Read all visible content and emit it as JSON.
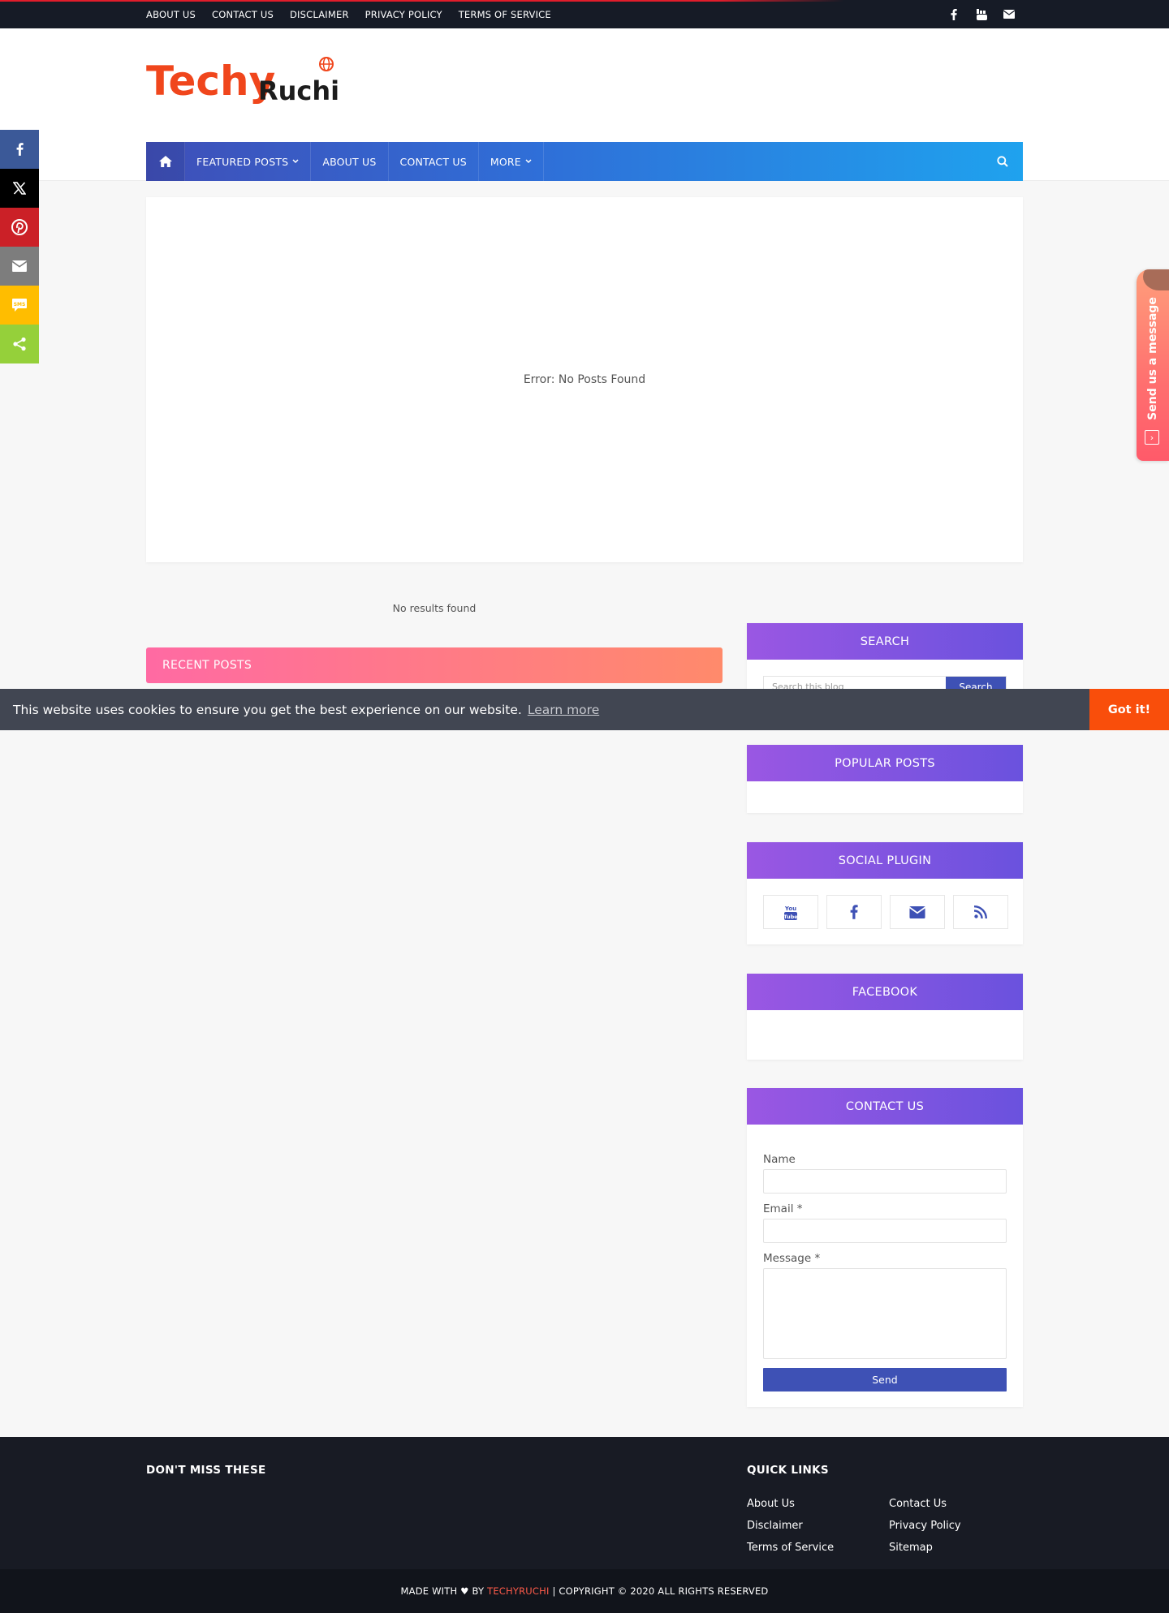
{
  "topbar": {
    "links": [
      "ABOUT US",
      "CONTACT US",
      "DISCLAIMER",
      "PRIVACY POLICY",
      "TERMS OF SERVICE"
    ],
    "social_icons": [
      "facebook-icon",
      "youtube-icon",
      "envelope-icon"
    ]
  },
  "logo": {
    "part1": "Techy",
    "part2": "Ruchi"
  },
  "nav": {
    "home_icon": "home-icon",
    "featured": "FEATURED POSTS",
    "about": "ABOUT US",
    "contact": "CONTACT US",
    "more": "MORE",
    "search_icon": "search-icon"
  },
  "featured": {
    "message": "Error: No Posts Found"
  },
  "main": {
    "no_results": "No results found",
    "recent_title": "RECENT POSTS"
  },
  "sidebar": {
    "search": {
      "title": "SEARCH",
      "placeholder": "Search this blog",
      "button": "Search"
    },
    "popular": {
      "title": "POPULAR POSTS"
    },
    "social": {
      "title": "SOCIAL PLUGIN",
      "icons": [
        "youtube-icon",
        "facebook-icon",
        "envelope-icon",
        "rss-icon"
      ]
    },
    "facebook": {
      "title": "FACEBOOK"
    },
    "contact": {
      "title": "CONTACT US",
      "name_label": "Name",
      "email_label": "Email *",
      "message_label": "Message *",
      "send": "Send"
    }
  },
  "cookie": {
    "text": "This website uses cookies to ensure you get the best experience on our website.",
    "learn_more": "Learn more",
    "got_it": "Got it!"
  },
  "footer": {
    "dont_miss": "DON'T MISS THESE",
    "quick_links_title": "QUICK LINKS",
    "quick_links": [
      "About Us",
      "Contact Us",
      "Disclaimer",
      "Privacy Policy",
      "Terms of Service",
      "Sitemap"
    ],
    "made_with": "MADE WITH ♥ BY",
    "brand": "TECHYRUCHI",
    "copyright": "| COPYRIGHT © 2020 ALL RIGHTS RESERVED"
  },
  "share_bar": {
    "buttons": [
      {
        "icon": "facebook-icon",
        "color": "#3b5998"
      },
      {
        "icon": "x-twitter-icon",
        "color": "#000000"
      },
      {
        "icon": "pinterest-icon",
        "color": "#cb2027"
      },
      {
        "icon": "email-icon",
        "color": "#7d7d7d"
      },
      {
        "icon": "sms-icon",
        "color": "#ffbd00"
      },
      {
        "icon": "share-icon",
        "color": "#95d03a"
      }
    ]
  },
  "message_tab": {
    "label": "Send us a message"
  },
  "colors": {
    "topbar_bg": "#161b26",
    "nav_gradient_start": "#3f4fb8",
    "nav_gradient_end": "#1fa2ee",
    "widget_gradient_start": "#9a57e3",
    "widget_gradient_end": "#6a52de",
    "recent_gradient_start": "#ff6aa3",
    "recent_gradient_end": "#ff8a6b",
    "button_blue": "#3e51b5",
    "cookie_bg": "#414652",
    "cookie_button": "#f94e0b",
    "footer_bg": "#181b24",
    "brand_red": "#ff5b4a"
  }
}
